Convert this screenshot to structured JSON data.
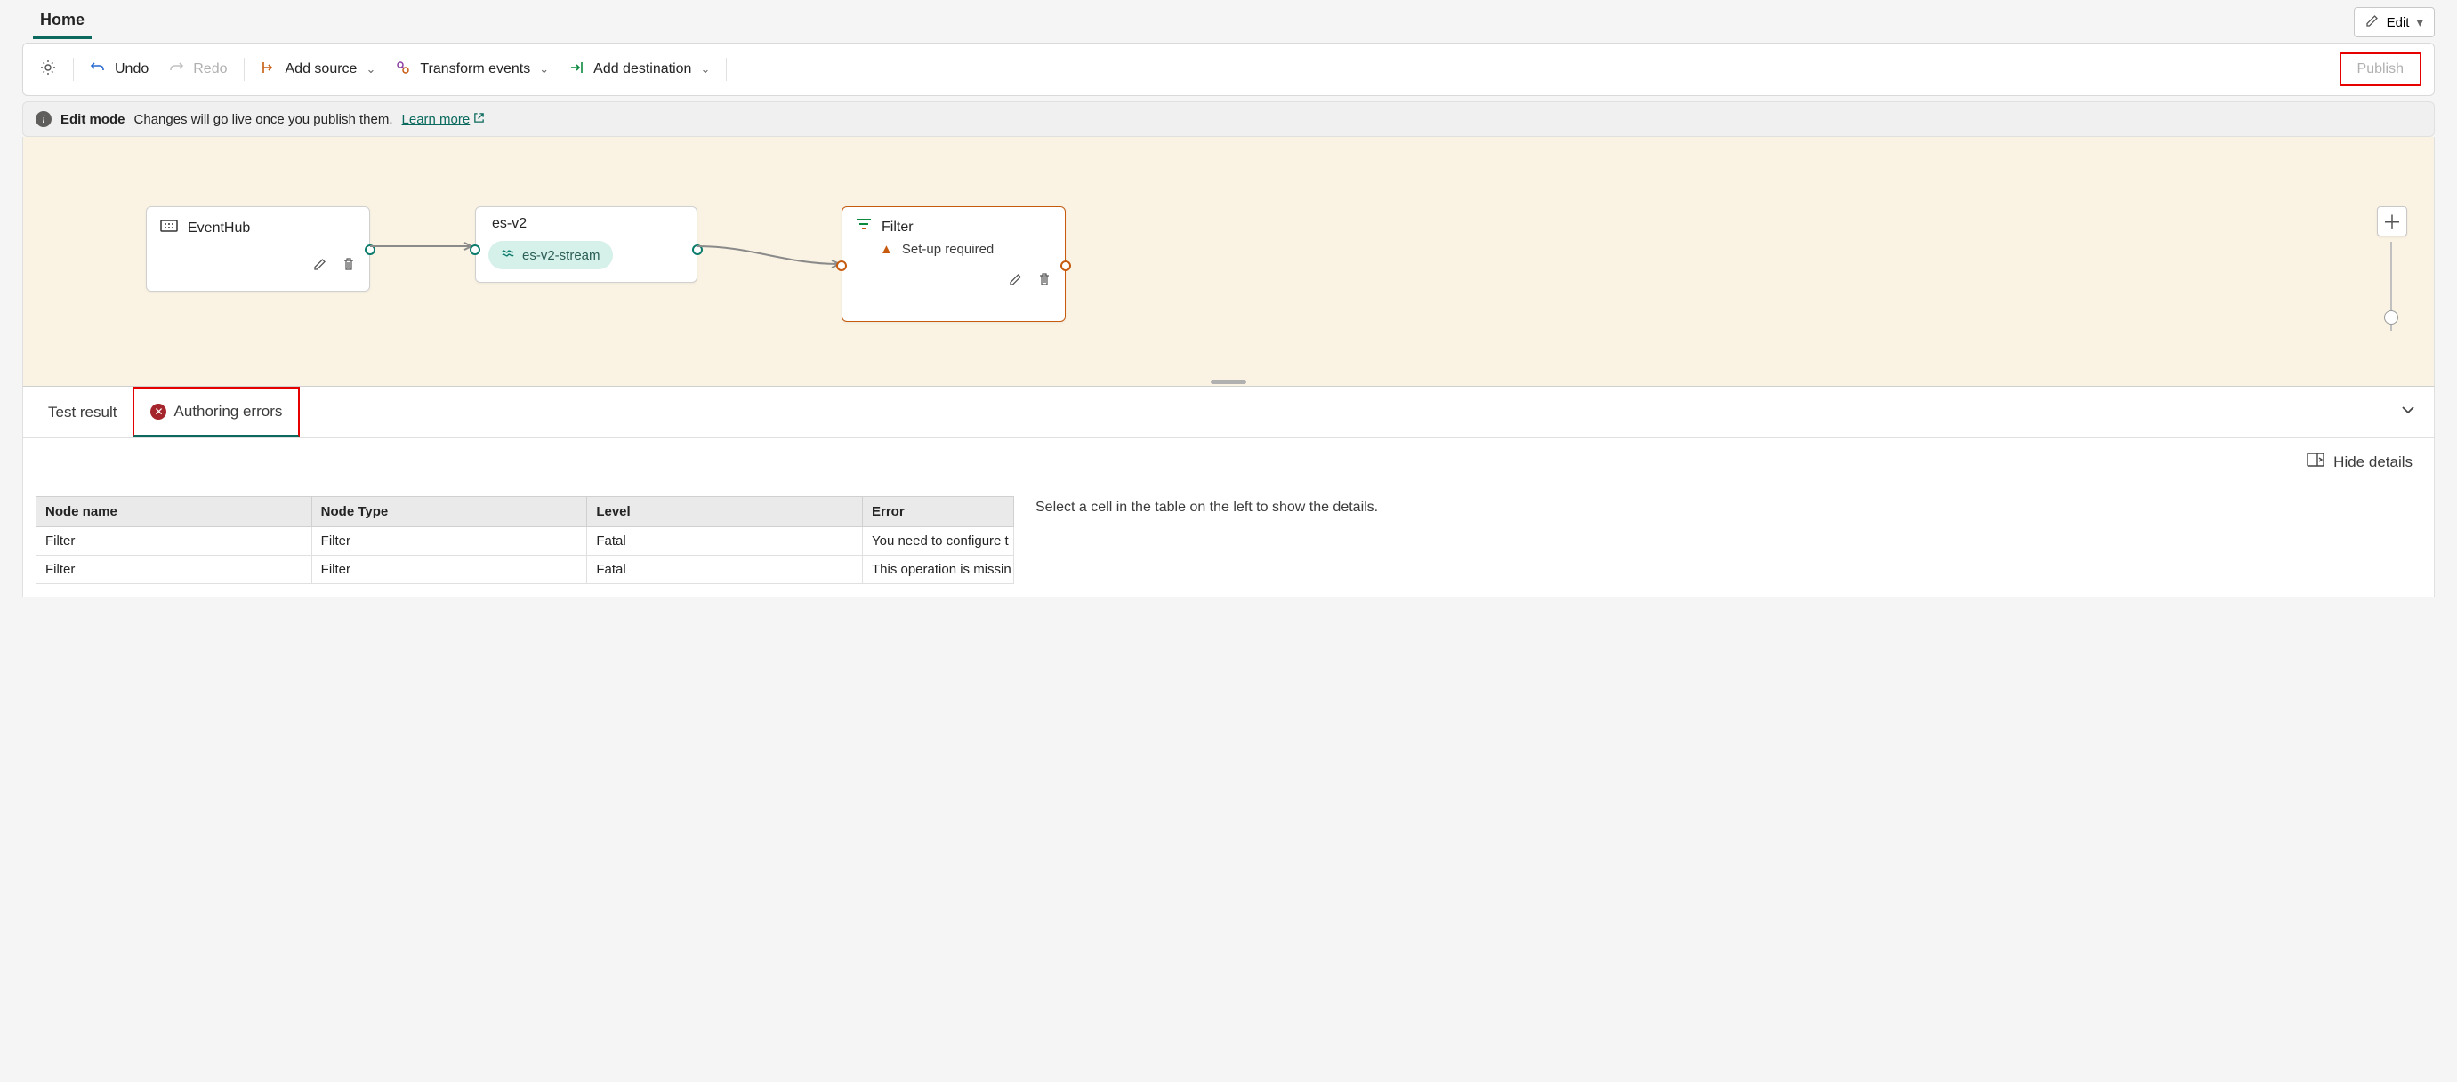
{
  "header": {
    "tab_home": "Home",
    "edit_label": "Edit"
  },
  "toolbar": {
    "undo": "Undo",
    "redo": "Redo",
    "add_source": "Add source",
    "transform": "Transform events",
    "add_destination": "Add destination",
    "publish": "Publish"
  },
  "banner": {
    "bold": "Edit mode",
    "text": "Changes will go live once you publish them.",
    "link": "Learn more"
  },
  "nodes": {
    "eventhub": {
      "title": "EventHub"
    },
    "esv2": {
      "title": "es-v2",
      "stream": "es-v2-stream"
    },
    "filter": {
      "title": "Filter",
      "warn": "Set-up required"
    }
  },
  "bottom_tabs": {
    "test_result": "Test result",
    "authoring_errors": "Authoring errors"
  },
  "details": {
    "hide_details": "Hide details",
    "side_hint": "Select a cell in the table on the left to show the details.",
    "columns": {
      "node_name": "Node name",
      "node_type": "Node Type",
      "level": "Level",
      "error": "Error"
    },
    "rows": [
      {
        "name": "Filter",
        "type": "Filter",
        "level": "Fatal",
        "error": "You need to configure t"
      },
      {
        "name": "Filter",
        "type": "Filter",
        "level": "Fatal",
        "error": "This operation is missin"
      }
    ]
  }
}
